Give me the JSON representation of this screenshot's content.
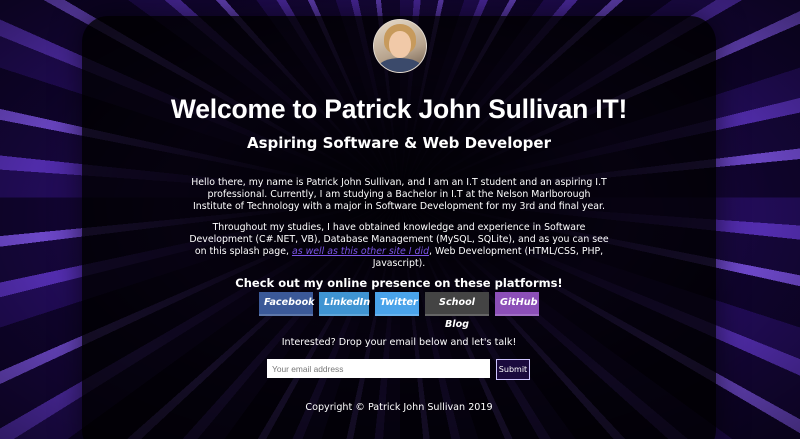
{
  "header": {
    "title": "Welcome to Patrick John Sullivan IT!",
    "subtitle": "Aspiring Software & Web Developer"
  },
  "intro": {
    "paragraph1": "Hello there, my name is Patrick John Sullivan, and I am an I.T student and an aspiring I.T professional. Currently, I am studying a Bachelor in I.T at the Nelson Marlborough Institute of Technology with a major in Software Development for my 3rd and final year.",
    "paragraph2_before": "Throughout my studies, I have obtained knowledge and experience in Software Development (C#.NET, VB), Database Management (MySQL, SQLite), and as you can see on this splash page, ",
    "paragraph2_link": "as well as this other site I did",
    "paragraph2_after": ", Web Development (HTML/CSS, PHP, Javascript)."
  },
  "presence": {
    "title": "Check out my online presence on these platforms!",
    "links": [
      {
        "label": "Facebook",
        "color": "#3b5998"
      },
      {
        "label": "LinkedIn",
        "color": "#3f94d2"
      },
      {
        "label": "Twitter",
        "color": "#4aa3ea"
      },
      {
        "label": "School Blog",
        "color": "#444444"
      },
      {
        "label": "GitHub",
        "color": "#8c4fb8"
      }
    ]
  },
  "contact": {
    "prompt": "Interested? Drop your email below and let's talk!",
    "email_placeholder": "Your email address",
    "submit_label": "Submit"
  },
  "footer": {
    "copyright": "Copyright © Patrick John Sullivan 2019"
  }
}
